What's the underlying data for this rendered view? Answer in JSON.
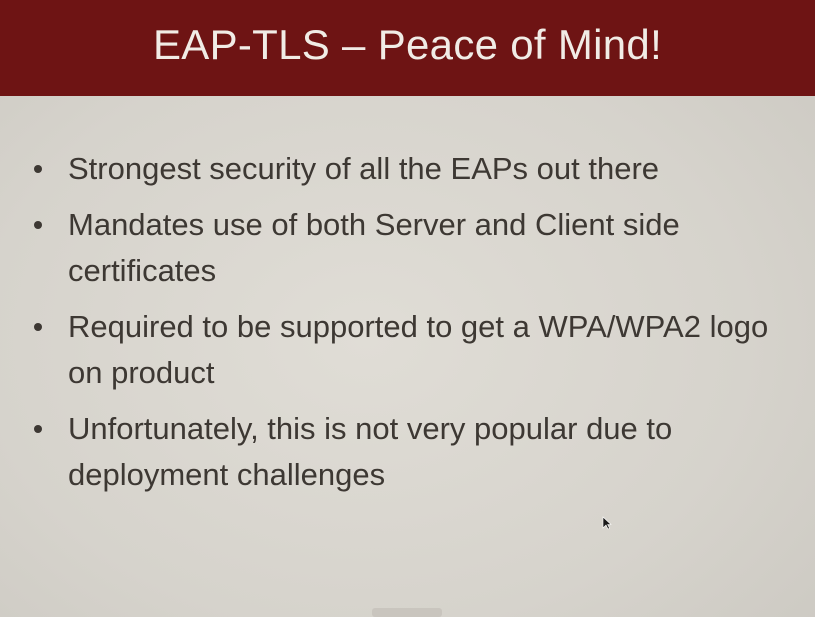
{
  "slide": {
    "title": "EAP-TLS – Peace of Mind!",
    "bullets": [
      "Strongest security of all the EAPs out there",
      "Mandates use of both Server and Client side certificates",
      "Required to be supported to get a WPA/WPA2 logo on product",
      "Unfortunately, this is not very popular due to deployment challenges"
    ]
  },
  "colors": {
    "title_bar": "#6e1414",
    "title_text": "#f1ece6",
    "body_text": "#3d3833",
    "background": "#d9d6cf"
  }
}
